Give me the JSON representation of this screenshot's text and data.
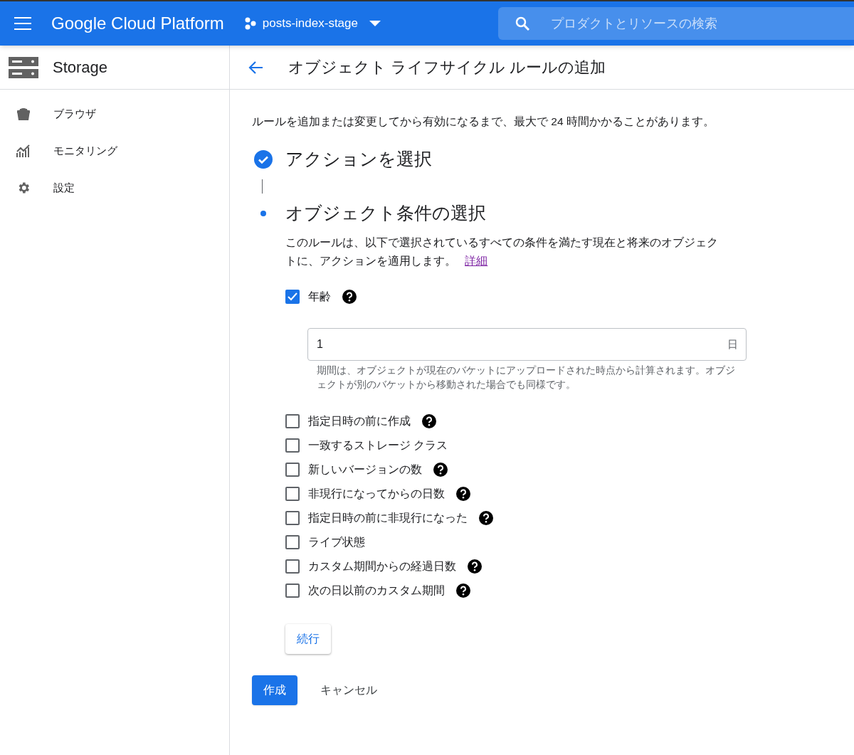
{
  "header": {
    "product": "Google Cloud Platform",
    "project": "posts-index-stage",
    "search": {
      "placeholder": "プロダクトとリソースの検索"
    }
  },
  "sidebar": {
    "title": "Storage",
    "items": [
      {
        "label": "ブラウザ",
        "kind": "bucket"
      },
      {
        "label": "モニタリング",
        "kind": "chart"
      },
      {
        "label": "設定",
        "kind": "gear"
      }
    ]
  },
  "page": {
    "title": "オブジェクト ライフサイクル ルールの追加",
    "notice": "ルールを追加または変更してから有効になるまで、最大で 24 時間かかることがあります。"
  },
  "steps": [
    {
      "title": "アクションを選択",
      "kind": "done"
    },
    {
      "title": "オブジェクト条件の選択",
      "kind": "current",
      "description": "このルールは、以下で選択されているすべての条件を満たす現在と将来のオブジェクトに、アクションを適用します。",
      "link": "詳細"
    }
  ],
  "conditions": [
    {
      "label": "年齢",
      "checked": true,
      "help": true,
      "field": {
        "value": "1",
        "suffix": "日",
        "hint": "期間は、オブジェクトが現在のバケットにアップロードされた時点から計算されます。オブジェクトが別のバケットから移動された場合でも同様です。"
      }
    },
    {
      "label": "指定日時の前に作成",
      "checked": false,
      "help": true
    },
    {
      "label": "一致するストレージ クラス",
      "checked": false,
      "help": false
    },
    {
      "label": "新しいバージョンの数",
      "checked": false,
      "help": true
    },
    {
      "label": "非現行になってからの日数",
      "checked": false,
      "help": true
    },
    {
      "label": "指定日時の前に非現行になった",
      "checked": false,
      "help": true
    },
    {
      "label": "ライブ状態",
      "checked": false,
      "help": false
    },
    {
      "label": "カスタム期間からの経過日数",
      "checked": false,
      "help": true
    },
    {
      "label": "次の日以前のカスタム期間",
      "checked": false,
      "help": true
    }
  ],
  "continue_button": "続行",
  "actions": {
    "create": "作成",
    "cancel": "キャンセル"
  }
}
